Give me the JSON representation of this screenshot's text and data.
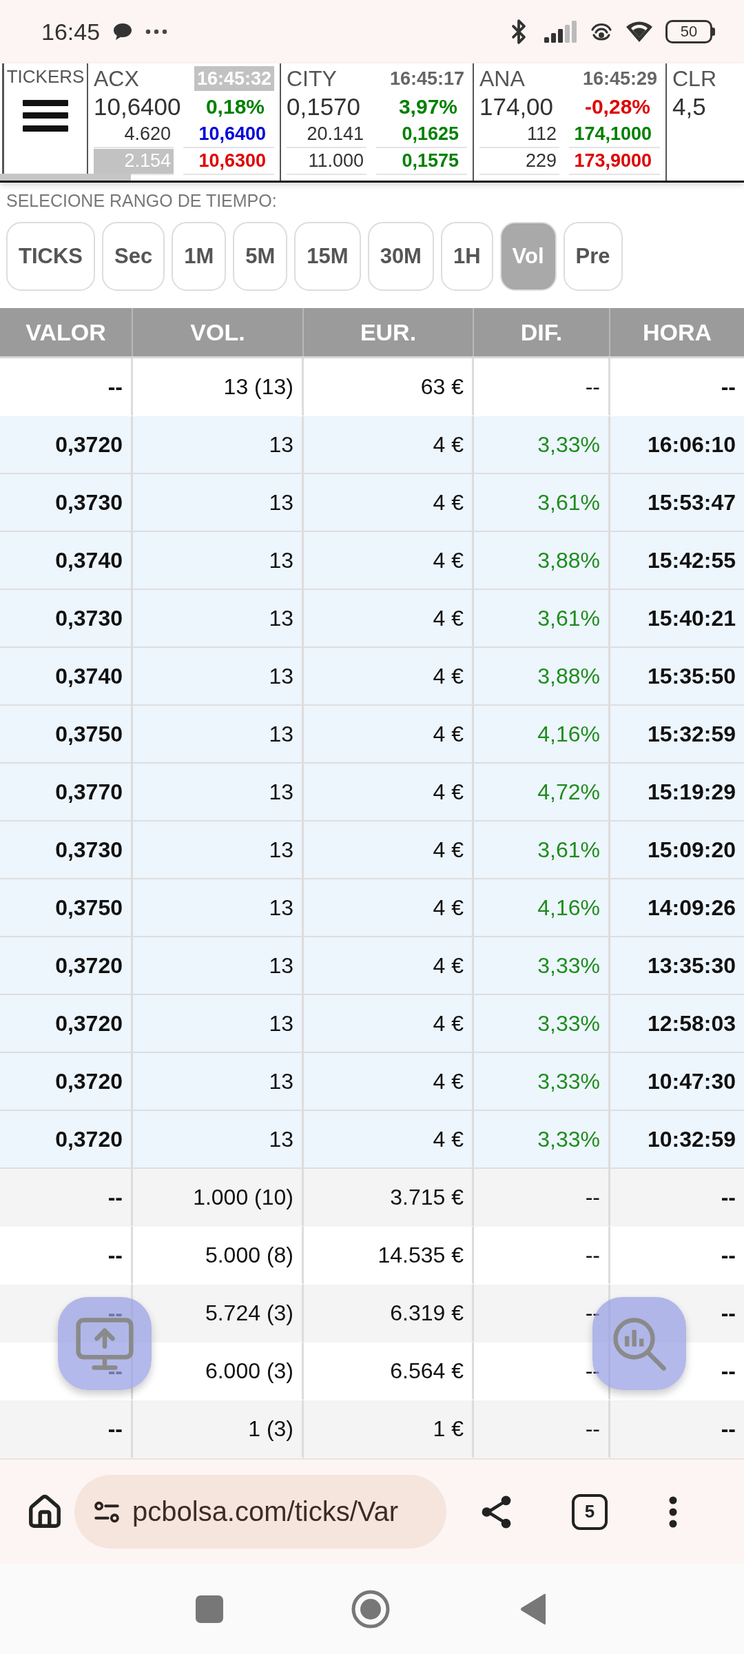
{
  "status_bar": {
    "time": "16:45",
    "battery": "50"
  },
  "tickers_menu": {
    "label": "TICKERS"
  },
  "tickers": [
    {
      "name": "ACX",
      "time": "16:45:32",
      "time_highlighted": true,
      "price": "10,6400",
      "change": {
        "text": "0,18%",
        "color": "#008000"
      },
      "quotes": [
        {
          "volume": "4.620",
          "price": "10,6400",
          "color": "#0000dd",
          "highlighted": false
        },
        {
          "volume": "2.154",
          "price": "10,6300",
          "color": "#e00000",
          "highlighted": true
        }
      ]
    },
    {
      "name": "CITY",
      "time": "16:45:17",
      "time_highlighted": false,
      "price": "0,1570",
      "change": {
        "text": "3,97%",
        "color": "#008000"
      },
      "quotes": [
        {
          "volume": "20.141",
          "price": "0,1625",
          "color": "#008000",
          "highlighted": false
        },
        {
          "volume": "11.000",
          "price": "0,1575",
          "color": "#008000",
          "highlighted": false
        }
      ]
    },
    {
      "name": "ANA",
      "time": "16:45:29",
      "time_highlighted": false,
      "price": "174,00",
      "change": {
        "text": "-0,28%",
        "color": "#e00000"
      },
      "quotes": [
        {
          "volume": "112",
          "price": "174,1000",
          "color": "#008000",
          "highlighted": false
        },
        {
          "volume": "229",
          "price": "173,9000",
          "color": "#e00000",
          "highlighted": false
        }
      ]
    },
    {
      "name": "CLR",
      "price": "4,5"
    }
  ],
  "time_range": {
    "label": "SELECIONE RANGO DE TIEMPO:",
    "options": [
      {
        "label": "TICKS",
        "selected": false
      },
      {
        "label": "Sec",
        "selected": false
      },
      {
        "label": "1M",
        "selected": false
      },
      {
        "label": "5M",
        "selected": false
      },
      {
        "label": "15M",
        "selected": false
      },
      {
        "label": "30M",
        "selected": false
      },
      {
        "label": "1H",
        "selected": false
      },
      {
        "label": "Vol",
        "selected": true
      },
      {
        "label": "Pre",
        "selected": false
      }
    ]
  },
  "table": {
    "columns": [
      "VALOR",
      "VOL.",
      "EUR.",
      "DIF.",
      "HORA"
    ],
    "rows": [
      {
        "kind": "total",
        "cells": [
          "--",
          "13 (13)",
          "63 €",
          "--",
          "--"
        ]
      },
      {
        "kind": "tick",
        "cells": [
          "0,3720",
          "13",
          "4 €",
          "3,33%",
          "16:06:10"
        ]
      },
      {
        "kind": "tick",
        "cells": [
          "0,3730",
          "13",
          "4 €",
          "3,61%",
          "15:53:47"
        ]
      },
      {
        "kind": "tick",
        "cells": [
          "0,3740",
          "13",
          "4 €",
          "3,88%",
          "15:42:55"
        ]
      },
      {
        "kind": "tick",
        "cells": [
          "0,3730",
          "13",
          "4 €",
          "3,61%",
          "15:40:21"
        ]
      },
      {
        "kind": "tick",
        "cells": [
          "0,3740",
          "13",
          "4 €",
          "3,88%",
          "15:35:50"
        ]
      },
      {
        "kind": "tick",
        "cells": [
          "0,3750",
          "13",
          "4 €",
          "4,16%",
          "15:32:59"
        ]
      },
      {
        "kind": "tick",
        "cells": [
          "0,3770",
          "13",
          "4 €",
          "4,72%",
          "15:19:29"
        ]
      },
      {
        "kind": "tick",
        "cells": [
          "0,3730",
          "13",
          "4 €",
          "3,61%",
          "15:09:20"
        ]
      },
      {
        "kind": "tick",
        "cells": [
          "0,3750",
          "13",
          "4 €",
          "4,16%",
          "14:09:26"
        ]
      },
      {
        "kind": "tick",
        "cells": [
          "0,3720",
          "13",
          "4 €",
          "3,33%",
          "13:35:30"
        ]
      },
      {
        "kind": "tick",
        "cells": [
          "0,3720",
          "13",
          "4 €",
          "3,33%",
          "12:58:03"
        ]
      },
      {
        "kind": "tick",
        "cells": [
          "0,3720",
          "13",
          "4 €",
          "3,33%",
          "10:47:30"
        ]
      },
      {
        "kind": "tick",
        "cells": [
          "0,3720",
          "13",
          "4 €",
          "3,33%",
          "10:32:59"
        ]
      },
      {
        "kind": "level",
        "cells": [
          "--",
          "1.000 (10)",
          "3.715 €",
          "--",
          "--"
        ]
      },
      {
        "kind": "level",
        "cells": [
          "--",
          "5.000 (8)",
          "14.535 €",
          "--",
          "--"
        ]
      },
      {
        "kind": "level",
        "cells": [
          "--",
          "5.724 (3)",
          "6.319 €",
          "--",
          "--"
        ]
      },
      {
        "kind": "level",
        "cells": [
          "--",
          "6.000 (3)",
          "6.564 €",
          "--",
          "--"
        ]
      },
      {
        "kind": "level",
        "cells": [
          "--",
          "1 (3)",
          "1 €",
          "--",
          "--"
        ]
      }
    ]
  },
  "browser": {
    "url": "pcbolsa.com/ticks/Var",
    "tab_count": "5"
  }
}
